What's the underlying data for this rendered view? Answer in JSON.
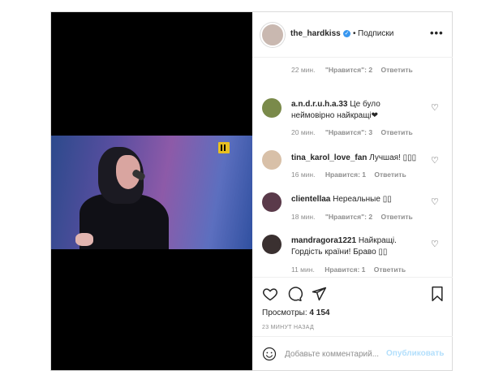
{
  "post": {
    "username": "the_hardkiss",
    "follow_label": "Подписки",
    "dot": "•",
    "more_label": "•••"
  },
  "comments": [
    {
      "partial": true,
      "time": "22 мин.",
      "likes": "\"Нравится\": 2",
      "reply": "Ответить"
    },
    {
      "username": "a.n.d.r.u.h.a.33",
      "text": "Це було неймовірно найкращі❤",
      "time": "20 мин.",
      "likes": "\"Нравится\": 3",
      "reply": "Ответить",
      "avatar_color": "#7a8a4a"
    },
    {
      "username": "tina_karol_love_fan",
      "text": "Лучшая! ▯▯▯",
      "time": "16 мин.",
      "likes": "Нравится: 1",
      "reply": "Ответить",
      "avatar_color": "#d8c0a8"
    },
    {
      "username": "clientellaa",
      "text": "Нереальные ▯▯",
      "time": "18 мин.",
      "likes": "\"Нравится\": 2",
      "reply": "Ответить",
      "avatar_color": "#5a3a4a"
    },
    {
      "username": "mandragora1221",
      "text": "Найкращі. Гордість країни! Браво ▯▯",
      "time": "11 мин.",
      "likes": "Нравится: 1",
      "reply": "Ответить",
      "avatar_color": "#3a3030"
    }
  ],
  "stats": {
    "views_label": "Просмотры:",
    "views_count": "4 154",
    "timestamp": "23 МИНУТ НАЗАД"
  },
  "composer": {
    "placeholder": "Добавьте комментарий...",
    "publish_label": "Опубликовать"
  },
  "colors": {
    "accent": "#3897f0",
    "publish_disabled": "#b2dffc"
  }
}
